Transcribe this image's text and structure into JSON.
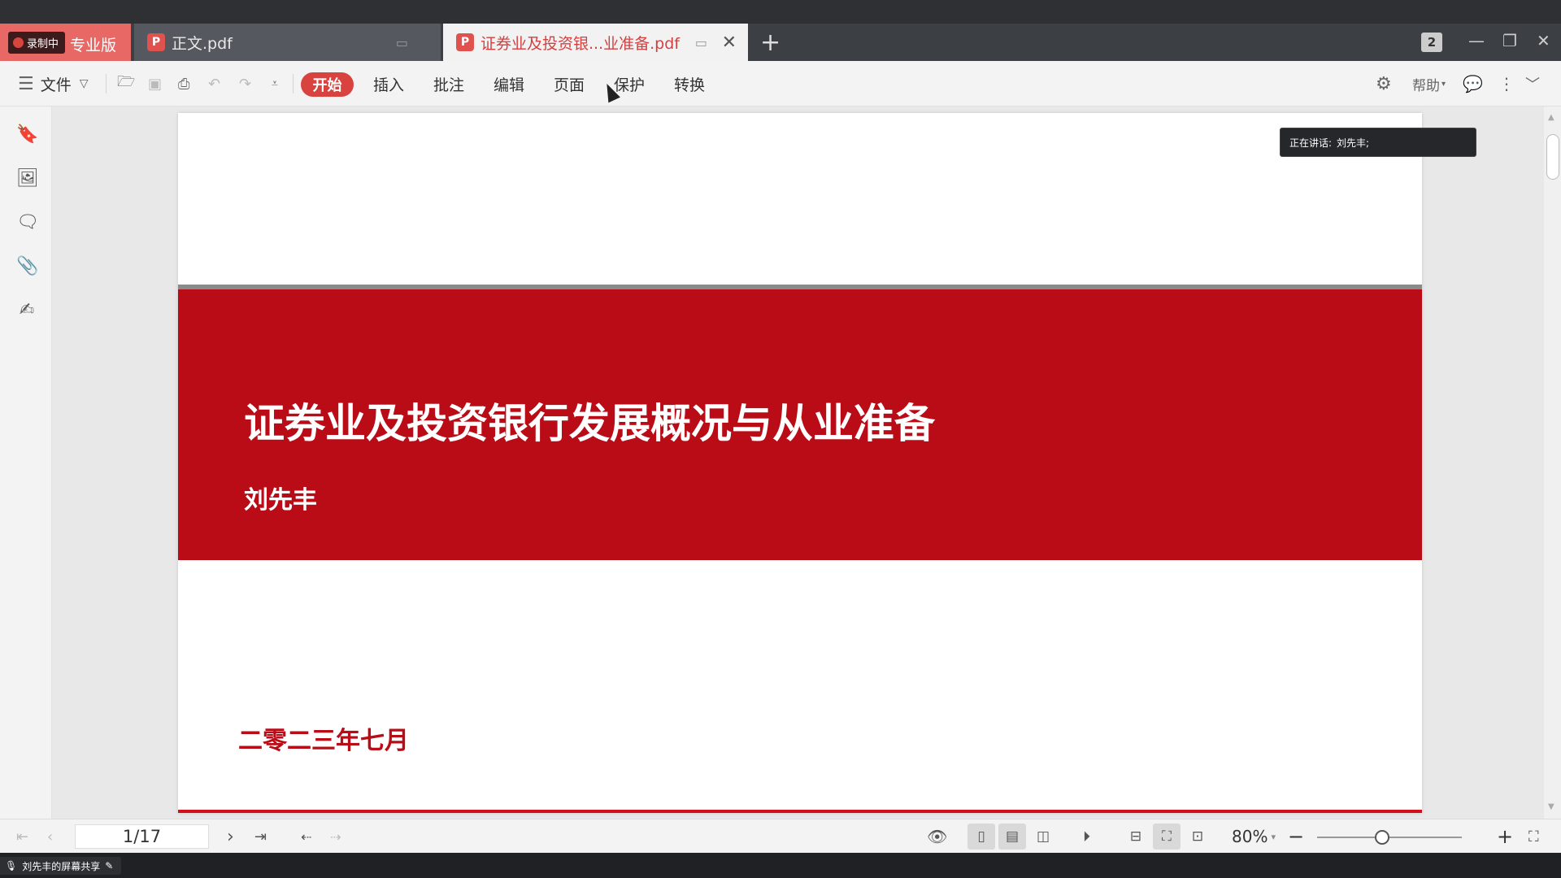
{
  "recording": {
    "badge": "录制中"
  },
  "tabs": [
    {
      "label": "专业版",
      "active": false
    },
    {
      "label": "正文.pdf",
      "active": false
    },
    {
      "label": "证券业及投资银...业准备.pdf",
      "active": true
    }
  ],
  "window": {
    "badge_count": "2"
  },
  "toolbar": {
    "file": "文件",
    "menu": [
      "开始",
      "插入",
      "批注",
      "编辑",
      "页面",
      "保护",
      "转换"
    ],
    "help": "帮助"
  },
  "document": {
    "title": "证券业及投资银行发展概况与从业准备",
    "author": "刘先丰",
    "date": "二零二三年七月"
  },
  "speaking": {
    "label": "正在讲话:",
    "name": "刘先丰;"
  },
  "status": {
    "page": "1/17",
    "zoom": "80%",
    "zoom_level": 0.45
  },
  "share": {
    "label": "刘先丰的屏幕共享"
  },
  "colors": {
    "accent": "#d9433f",
    "band": "#b90c17"
  }
}
